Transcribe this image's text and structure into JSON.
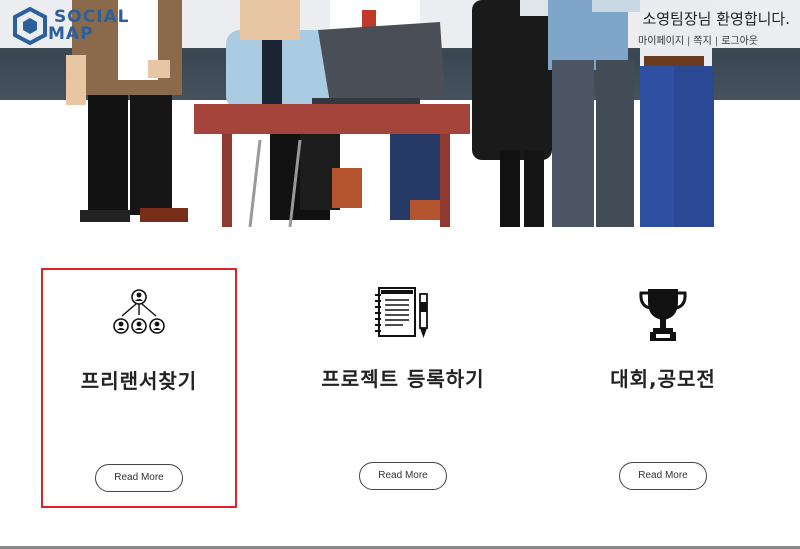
{
  "brand": {
    "logo_line1": "SOCIAL",
    "logo_line2": "MAP",
    "logo_icon": "hexagon-logo-icon"
  },
  "header": {
    "welcome": "소영팀장님 환영합니다.",
    "links": {
      "mypage": "마이페이지",
      "messages": "쪽지",
      "logout": "로그아웃"
    },
    "separator": "|"
  },
  "services": [
    {
      "icon": "people-network-icon",
      "title": "프리랜서찾기",
      "button": "Read More",
      "selected": true
    },
    {
      "icon": "notebook-pen-icon",
      "title": "프로젝트 등록하기",
      "button": "Read More",
      "selected": false
    },
    {
      "icon": "trophy-icon",
      "title": "대회,공모전",
      "button": "Read More",
      "selected": false
    }
  ],
  "colors": {
    "brand_blue": "#2c5f9e",
    "selection_red": "#e0232a"
  }
}
